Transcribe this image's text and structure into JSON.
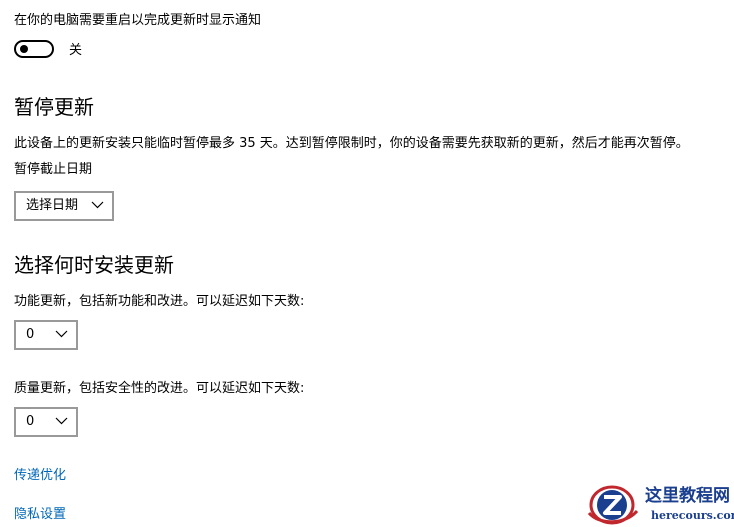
{
  "restart_notify": {
    "label": "在你的电脑需要重启以完成更新时显示通知",
    "toggle_state_label": "关",
    "toggle_on": false
  },
  "pause_updates": {
    "heading": "暂停更新",
    "description": "此设备上的更新安装只能临时暂停最多 35 天。达到暂停限制时，你的设备需要先获取新的更新，然后才能再次暂停。",
    "until_label": "暂停截止日期",
    "date_dropdown_value": "选择日期"
  },
  "choose_when": {
    "heading": "选择何时安装更新",
    "feature_label": "功能更新，包括新功能和改进。可以延迟如下天数:",
    "feature_value": "0",
    "quality_label": "质量更新，包括安全性的改进。可以延迟如下天数:",
    "quality_value": "0"
  },
  "links": {
    "delivery_optimization": "传递优化",
    "privacy_settings": "隐私设置"
  },
  "watermark": {
    "title": "这里教程网",
    "url": "herecours.com"
  },
  "colors": {
    "link": "#0067b8",
    "text": "#000000",
    "dropdown_border": "#999999",
    "watermark_blue": "#1b3f8f",
    "watermark_red": "#c0282e"
  },
  "icons": {
    "dropdown": "chevron-down-icon",
    "watermark_logo": "z-globe-logo-icon"
  }
}
